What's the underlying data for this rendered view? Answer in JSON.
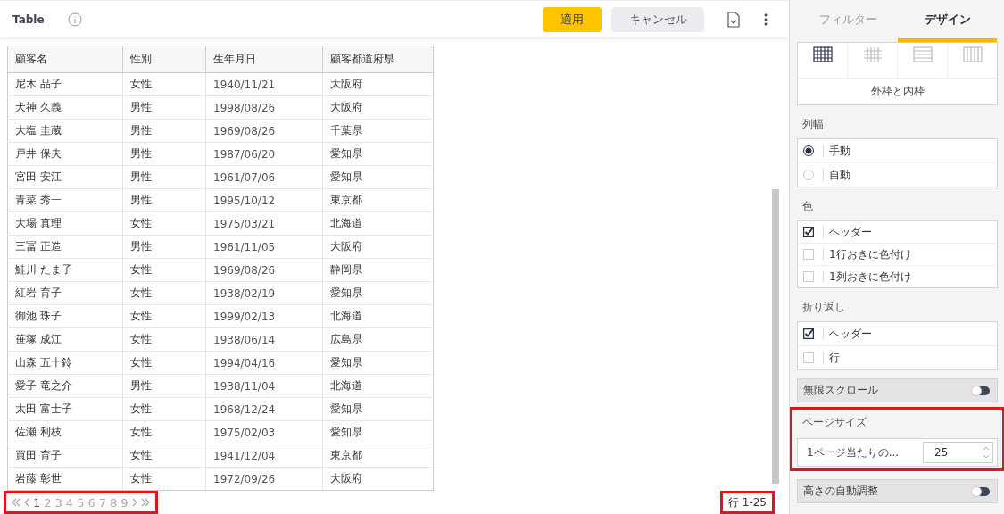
{
  "header": {
    "title": "Table",
    "apply_button": "適用",
    "cancel_button": "キャンセル"
  },
  "table": {
    "columns": [
      "顧客名",
      "性別",
      "生年月日",
      "顧客都道府県"
    ],
    "rows": [
      [
        "尼木 品子",
        "女性",
        "1940/11/21",
        "大阪府"
      ],
      [
        "犬神 久義",
        "男性",
        "1998/08/26",
        "大阪府"
      ],
      [
        "大塩 圭蔵",
        "男性",
        "1969/08/26",
        "千葉県"
      ],
      [
        "戸井 保夫",
        "男性",
        "1987/06/20",
        "愛知県"
      ],
      [
        "宮田 安江",
        "男性",
        "1961/07/06",
        "愛知県"
      ],
      [
        "青菜 秀一",
        "男性",
        "1995/10/12",
        "東京都"
      ],
      [
        "大場 真理",
        "女性",
        "1975/03/21",
        "北海道"
      ],
      [
        "三冨 正造",
        "男性",
        "1961/11/05",
        "大阪府"
      ],
      [
        "鮭川 たま子",
        "女性",
        "1969/08/26",
        "静岡県"
      ],
      [
        "紅岩 育子",
        "女性",
        "1938/02/19",
        "愛知県"
      ],
      [
        "御池 珠子",
        "女性",
        "1999/02/13",
        "北海道"
      ],
      [
        "笹塚 成江",
        "女性",
        "1938/06/14",
        "広島県"
      ],
      [
        "山森 五十鈴",
        "女性",
        "1994/04/16",
        "愛知県"
      ],
      [
        "愛子 竜之介",
        "男性",
        "1938/11/04",
        "北海道"
      ],
      [
        "太田 富士子",
        "女性",
        "1968/12/24",
        "愛知県"
      ],
      [
        "佐瀬 利枝",
        "女性",
        "1975/02/03",
        "愛知県"
      ],
      [
        "買田 育子",
        "女性",
        "1941/12/04",
        "東京都"
      ],
      [
        "岩藤 彰世",
        "女性",
        "1972/09/26",
        "大阪府"
      ]
    ]
  },
  "pagination": {
    "pages": [
      {
        "label": "1",
        "selected": true
      },
      {
        "label": "2",
        "selected": false
      },
      {
        "label": "3",
        "selected": false
      },
      {
        "label": "4",
        "selected": false
      },
      {
        "label": "5",
        "selected": false
      },
      {
        "label": "6",
        "selected": false
      },
      {
        "label": "7",
        "selected": false
      },
      {
        "label": "8",
        "selected": false
      },
      {
        "label": "9",
        "selected": false
      }
    ],
    "row_range": "行 1-25"
  },
  "panel": {
    "tabs": [
      {
        "label": "フィルター",
        "selected": false
      },
      {
        "label": "デザイン",
        "selected": true
      }
    ],
    "border_styles": [
      {
        "kind": "all",
        "selected": true
      },
      {
        "kind": "inner",
        "selected": false
      },
      {
        "kind": "rows",
        "selected": false
      },
      {
        "kind": "columns",
        "selected": false
      }
    ],
    "border_label": "外枠と内枠",
    "column_width": {
      "label": "列幅",
      "options": [
        {
          "label": "手動",
          "selected": true
        },
        {
          "label": "自動",
          "selected": false
        }
      ]
    },
    "color": {
      "label": "色",
      "options": [
        {
          "label": "ヘッダー",
          "checked": true
        },
        {
          "label": "1行おきに色付け",
          "checked": false
        },
        {
          "label": "1列おきに色付け",
          "checked": false
        }
      ]
    },
    "wrap": {
      "label": "折り返し",
      "options": [
        {
          "label": "ヘッダー",
          "checked": true
        },
        {
          "label": "行",
          "checked": false
        }
      ]
    },
    "infinite_scroll": {
      "label": "無限スクロール",
      "on": false
    },
    "page_size": {
      "label": "ページサイズ",
      "field_label": "1ページ当たりの...",
      "value": "25"
    },
    "auto_height": {
      "label": "高さの自動調整",
      "on": false
    }
  }
}
